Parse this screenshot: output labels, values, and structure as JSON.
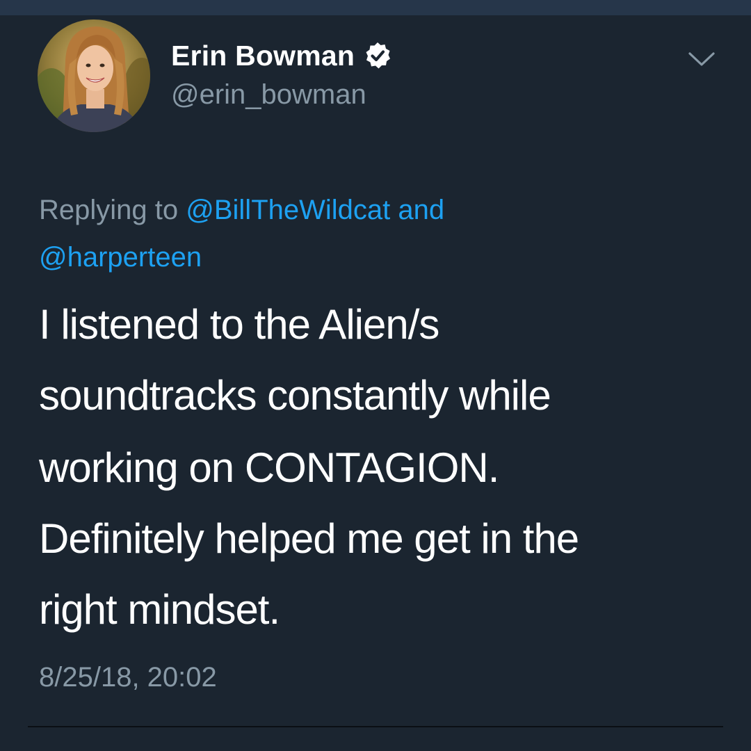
{
  "tweet": {
    "author": {
      "display_name": "Erin Bowman",
      "handle": "@erin_bowman",
      "verified": true,
      "avatar_icon": "profile-photo"
    },
    "menu_icon": "chevron-down-icon",
    "reply_context": {
      "prefix": "Replying to",
      "mention_1": "@BillTheWildcat",
      "conjunction": "and",
      "mention_2": "@harperteen"
    },
    "text_lines": [
      "I listened to the Alien/s",
      "soundtracks constantly while",
      "working on CONTAGION.",
      "Definitely helped me get in the",
      "right mindset."
    ],
    "timestamp": "8/25/18, 20:02"
  },
  "colors": {
    "background": "#1b2530",
    "text_primary": "#ffffff",
    "text_muted": "#8899a6",
    "link": "#1da1f2"
  }
}
